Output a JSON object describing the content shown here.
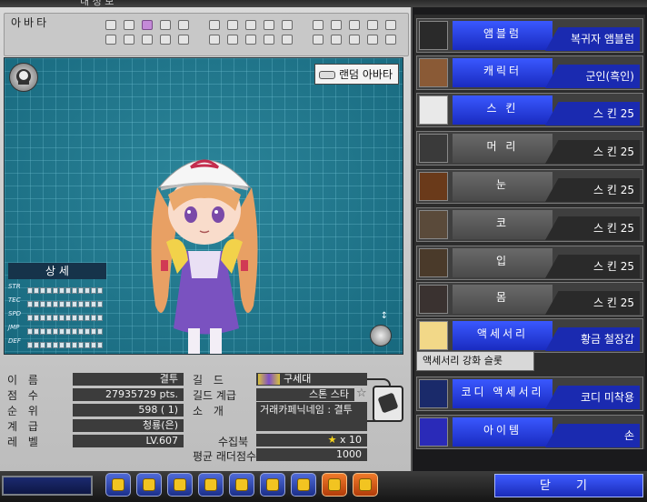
{
  "window": {
    "title_fragment": "내 정 보"
  },
  "avatar_selector": {
    "label": "아바타",
    "active_index": 2
  },
  "preview": {
    "random_avatar_label": "랜덤 아바타",
    "stats_title": "상 세",
    "stats": [
      {
        "key": "STR",
        "level": 0
      },
      {
        "key": "TEC",
        "level": 0
      },
      {
        "key": "SPD",
        "level": 0
      },
      {
        "key": "JMP",
        "level": 0
      },
      {
        "key": "DEF",
        "level": 0
      }
    ]
  },
  "profile": {
    "name_label": "이 름",
    "name": "결투",
    "score_label": "점 수",
    "score": "27935729 pts.",
    "rank_label": "순 위",
    "rank": "598 (  1)",
    "grade_label": "계 급",
    "grade": "청룡(은)",
    "level_label": "레 벨",
    "level": "LV.607"
  },
  "guild": {
    "guild_label": "길 드",
    "guild_name": "구세대",
    "guild_grade_label": "길드 계급",
    "guild_grade": "스톤 스타",
    "intro_label": "소 개",
    "intro": "거래카페닉네임 : 결투",
    "collection_label": "수집북",
    "collection_value": "x 10",
    "ladder_label": "평균 래더점수",
    "ladder_value": "1000"
  },
  "sidebar": [
    {
      "id": "emblem",
      "label": "앰블럼",
      "value": "복귀자 앰블럼",
      "style": "blue"
    },
    {
      "id": "character",
      "label": "캐릭터",
      "value": "군인(흑인)",
      "style": "blue"
    },
    {
      "id": "skin",
      "label": "스 킨",
      "value": "스 킨 25",
      "style": "blue"
    },
    {
      "id": "hair",
      "label": "머 리",
      "value": "스 킨 25",
      "style": "gray"
    },
    {
      "id": "eyes",
      "label": "눈",
      "value": "스 킨 25",
      "style": "gray"
    },
    {
      "id": "nose",
      "label": "코",
      "value": "스 킨 25",
      "style": "gray"
    },
    {
      "id": "mouth",
      "label": "입",
      "value": "스 킨 25",
      "style": "gray"
    },
    {
      "id": "body",
      "label": "몸",
      "value": "스 킨 25",
      "style": "gray"
    },
    {
      "id": "accessory",
      "label": "액세서리",
      "value": "황금 철장갑",
      "style": "blue"
    },
    {
      "id": "codi-accessory",
      "label": "코디 액세서리",
      "value": "코디 미착용",
      "style": "blue"
    },
    {
      "id": "item",
      "label": "아이템",
      "value": "손",
      "style": "blue"
    }
  ],
  "accessory_slot_label": "액세서리 강화 슬롯",
  "close_button": "닫 기",
  "colors": {
    "accent_blue": "#2a3fe8",
    "preview_bg": "#1f7e94"
  },
  "toolbar_icons": [
    "shop-icon",
    "chat-icon",
    "box-icon",
    "shield-icon",
    "star-icon",
    "bag-icon",
    "bell-icon",
    "ranking-icon",
    "card-icon"
  ]
}
